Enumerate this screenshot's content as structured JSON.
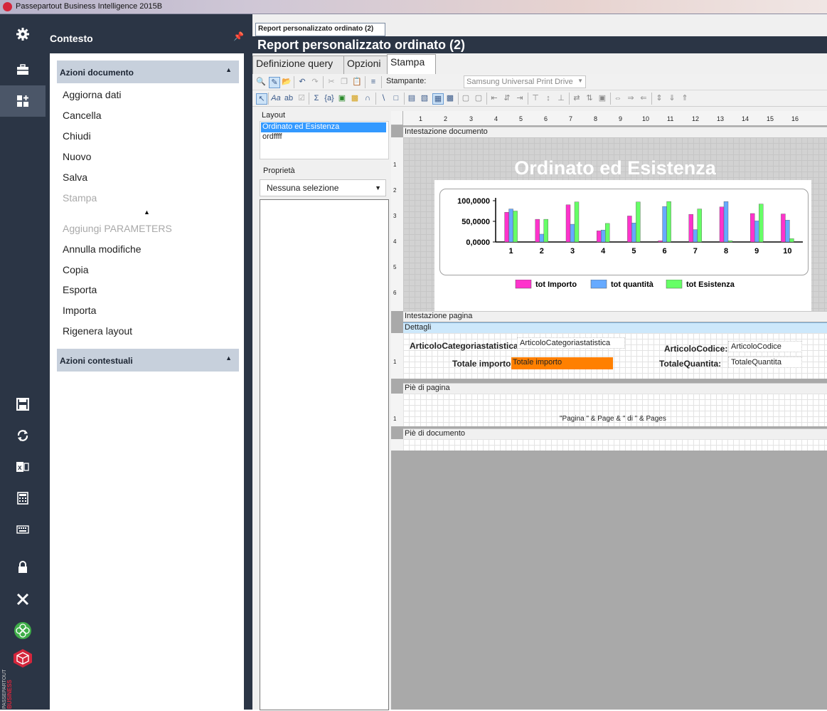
{
  "app": {
    "title": "Passepartout Business Intelligence 2015B"
  },
  "rail": {
    "icons": [
      "gear-icon",
      "briefcase-icon",
      "dashboard-add-icon",
      "save-icon",
      "refresh-icon",
      "excel-icon",
      "calculator-icon",
      "keyboard-icon",
      "lock-icon",
      "close-icon",
      "flower-logo-icon",
      "cube-logo-icon"
    ],
    "brand_text": "PASSEPARTOUT BUSINESS INTELLIGENCE"
  },
  "context_panel": {
    "title": "Contesto",
    "group1": {
      "title": "Azioni documento",
      "items": [
        "Aggiorna dati",
        "Cancella",
        "Chiudi",
        "Nuovo",
        "Salva",
        "Stampa",
        "Aggiungi PARAMETERS",
        "Annulla modifiche",
        "Copia",
        "Esporta",
        "Importa",
        "Rigenera layout"
      ],
      "disabled": [
        "Stampa",
        "Aggiungi PARAMETERS"
      ]
    },
    "group2": {
      "title": "Azioni contestuali"
    }
  },
  "document": {
    "tab_label": "Report personalizzato ordinato (2)",
    "header_title": "Report personalizzato ordinato (2)",
    "subtabs": [
      "Definizione query",
      "Opzioni",
      "Stampa"
    ],
    "active_subtab": "Stampa"
  },
  "toolbar": {
    "printer_label": "Stampante:",
    "printer_value": "Samsung Universal Print Drive"
  },
  "layout_panel": {
    "title": "Layout",
    "items": [
      "Ordinato ed Esistenza",
      "ordffff"
    ],
    "selected": "Ordinato ed Esistenza",
    "properties_label": "Proprietà",
    "properties_select": "Nessuna selezione"
  },
  "designer": {
    "ruler_marks": [
      "1",
      "2",
      "3",
      "4",
      "5",
      "6",
      "7",
      "8",
      "9",
      "10",
      "11",
      "12",
      "13",
      "14",
      "15",
      "16"
    ],
    "bands": {
      "doc_header": "Intestazione documento",
      "page_header": "Intestazione pagina",
      "details": "Dettagli",
      "page_footer": "Piè di pagina",
      "doc_footer": "Piè di documento"
    },
    "report_title": "Ordinato ed Esistenza",
    "details_fields": {
      "cat_label": "ArticoloCategoriastatistica",
      "cat_value": "ArticoloCategoriastatistica",
      "code_label": "ArticoloCodice:",
      "code_value": "ArticoloCodice",
      "tot_imp_label": "Totale importo:",
      "tot_imp_value": "Totale importo",
      "tot_qty_label": "TotaleQuantita:",
      "tot_qty_value": "TotaleQuantita"
    },
    "footer_expr": "\"Pagina \" & Page & \" di \" & Pages",
    "vruler_header": [
      "1",
      "2",
      "3",
      "4",
      "5",
      "6"
    ],
    "vruler_details": [
      "1"
    ],
    "vruler_footer": [
      "1"
    ]
  },
  "chart_data": {
    "type": "bar",
    "categories": [
      "1",
      "2",
      "3",
      "4",
      "5",
      "6",
      "7",
      "8",
      "9",
      "10"
    ],
    "series": [
      {
        "name": "tot Importo",
        "color": "#ff33cc",
        "values": [
          72000,
          55000,
          90000,
          27000,
          63000,
          3000,
          67000,
          85000,
          69000,
          68000
        ]
      },
      {
        "name": "tot quantità",
        "color": "#66aaff",
        "values": [
          80000,
          19000,
          43000,
          29000,
          46000,
          86000,
          30000,
          98000,
          51000,
          53000
        ]
      },
      {
        "name": "tot Esistenza",
        "color": "#66ff66",
        "values": [
          75000,
          55000,
          97000,
          45000,
          97000,
          98000,
          80000,
          3000,
          92000,
          8000
        ]
      }
    ],
    "y_ticks": [
      "100,0000",
      "50,0000",
      "0,0000"
    ],
    "ylim": [
      0,
      100000
    ]
  },
  "colors": {
    "rail_bg": "#2b3545",
    "selected_blue": "#3399ff",
    "orange_field": "#ff8000"
  }
}
